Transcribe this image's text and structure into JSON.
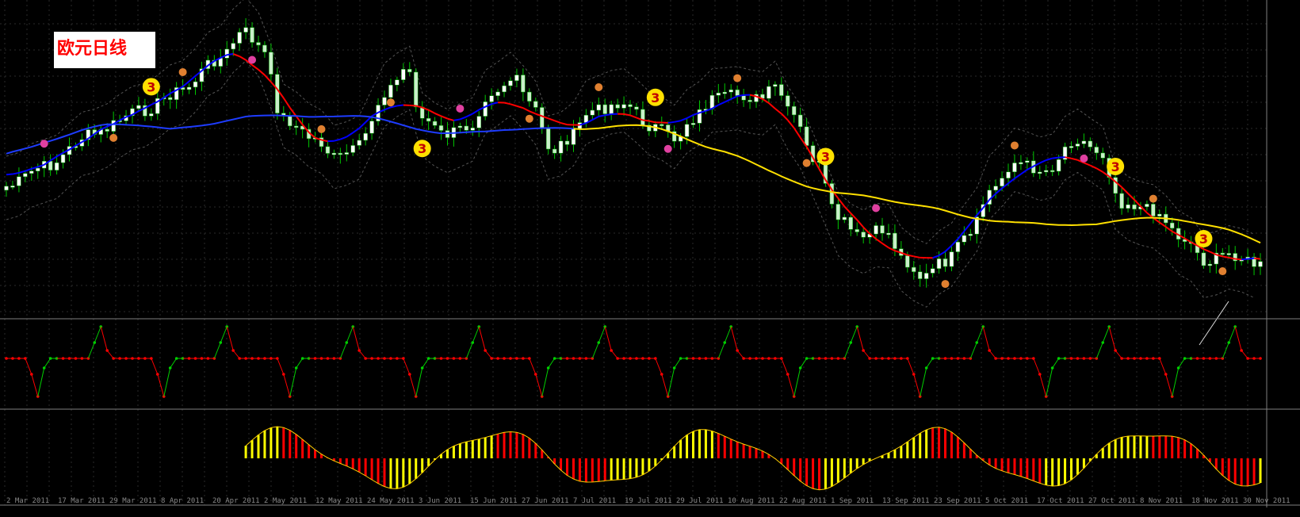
{
  "chart_data": [
    {
      "type": "candlestick",
      "title": "欧元日线",
      "x_tick_labels": [
        "2 Mar 2011",
        "17 Mar 2011",
        "29 Mar 2011",
        "8 Apr 2011",
        "20 Apr 2011",
        "2 May 2011",
        "12 May 2011",
        "24 May 2011",
        "3 Jun 2011",
        "15 Jun 2011",
        "27 Jun 2011",
        "7 Jul 2011",
        "19 Jul 2011",
        "29 Jul 2011",
        "10 Aug 2011",
        "22 Aug 2011",
        "1 Sep 2011",
        "13 Sep 2011",
        "23 Sep 2011",
        "5 Oct 2011",
        "17 Oct 2011",
        "27 Oct 2011",
        "8 Nov 2011",
        "18 Nov 2011",
        "30 Nov 2011"
      ],
      "markers_value": "3",
      "colors": {
        "bull_candle": "#ffffff",
        "bear_candle": "#c8f0c8",
        "wick": "#00c800",
        "fast_ma_up": "#0000ff",
        "fast_ma_down": "#ff0000",
        "slow_ma": "#1e3cff",
        "slow_ma_late": "#ffe000",
        "marker": "#ffe000",
        "band": "#555555"
      }
    },
    {
      "type": "line",
      "pane": "oscillator",
      "levels": [
        "high",
        "mid",
        "low"
      ],
      "colors": {
        "up": "#00d000",
        "down": "#ff0000"
      }
    },
    {
      "type": "bar",
      "pane": "histogram",
      "colors": {
        "up": "#ffff00",
        "down": "#ff0000",
        "signal": "#ffd000"
      }
    }
  ]
}
